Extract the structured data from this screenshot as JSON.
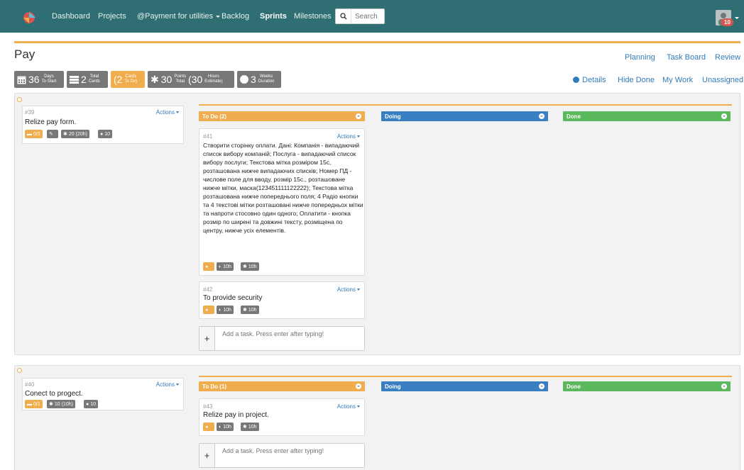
{
  "nav": {
    "items": [
      {
        "label": "Dashboard",
        "active": false
      },
      {
        "label": "Projects",
        "active": false
      },
      {
        "label": "@Payment for utilities",
        "active": false,
        "dropdown": true
      },
      {
        "label": "Backlog",
        "active": false
      },
      {
        "label": "Sprints",
        "active": true
      },
      {
        "label": "Milestones",
        "active": false
      }
    ],
    "search_placeholder": "Search",
    "notification_count": "10"
  },
  "page": {
    "title": "Pay",
    "top_links": [
      "Planning",
      "Task Board",
      "Review"
    ],
    "sub_links": [
      "Details",
      "Hide Done",
      "My Work",
      "Unassigned"
    ]
  },
  "stats": [
    {
      "value": "36",
      "line1": "Days",
      "line2": "To Start"
    },
    {
      "value": "2",
      "line1": "Total",
      "line2": "Cards"
    },
    {
      "value": "(2",
      "line1": "Cards",
      "line2": "To Do)"
    },
    {
      "value": "30",
      "line1": "Points",
      "line2": "Total"
    },
    {
      "value": "(30",
      "line1": "Hours",
      "line2": "Estimate)"
    },
    {
      "value": "3",
      "line1": "Weeks",
      "line2": "Duration"
    }
  ],
  "sprints": [
    {
      "story": {
        "id": "#39",
        "title": "Relize pay form.",
        "actions": "Actions",
        "pills": [
          "0/2",
          "",
          "20 (20h)",
          "10"
        ]
      },
      "columns": [
        "To Do (2)",
        "Doing",
        "Done"
      ],
      "tasks": [
        {
          "id": "#41",
          "actions": "Actions",
          "text": "Створити сторінку оплати. Дані: Компанія - випадаючий список вибору компаній; Послуга - випадаючий список вибору послуги; Текстова мітка розміром 15с, розташована нижче випадаючих списків; Номер ПД - числове поле для вводу, розмір 15с., розташоване нижче мітки, маска(123451111122222); Текстова мітка розташована нижче попереднього поля; 4 Радіо кнопки та 4 текстові мітки розташовані нижче попередньох мітки та напроти стосовно один одного; Оплатити - кнопка розмір по ширені та довжині тексту, розміщена по центру, нижче усіх елементів.",
          "pills": [
            "",
            "10h",
            "10h"
          ]
        },
        {
          "id": "#42",
          "actions": "Actions",
          "text": "To provide security",
          "pills": [
            "",
            "10h",
            "10h"
          ]
        }
      ],
      "add_placeholder": "Add a task. Press enter after typing!"
    },
    {
      "story": {
        "id": "#40",
        "title": "Conect to progect.",
        "actions": "Actions",
        "pills": [
          "0/1",
          "10 (10h)",
          "10"
        ]
      },
      "columns": [
        "To Do (1)",
        "Doing",
        "Done"
      ],
      "tasks": [
        {
          "id": "#43",
          "actions": "Actions",
          "text": "Relize pay in project.",
          "pills": [
            "",
            "10h",
            "10h"
          ]
        }
      ],
      "add_placeholder": "Add a task. Press enter after typing!"
    }
  ],
  "colors": {
    "nav": "#2f6f73",
    "accent": "#f0ad4e",
    "doing": "#3a7fc1",
    "done": "#5cb85c",
    "link": "#337ab7",
    "badge": "#777777"
  }
}
